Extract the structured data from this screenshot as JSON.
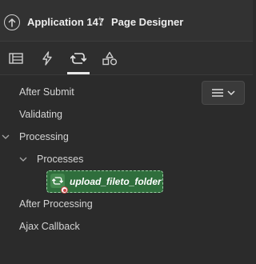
{
  "header": {
    "app_title": "Application 147",
    "separator": "\\",
    "page_title": "Page Designer"
  },
  "tabs": [
    {
      "name": "rendering",
      "icon": "layout-icon",
      "active": false
    },
    {
      "name": "dynamic-actions",
      "icon": "lightning-icon",
      "active": false
    },
    {
      "name": "processing",
      "icon": "refresh-icon",
      "active": true
    },
    {
      "name": "shared-components",
      "icon": "shapes-icon",
      "active": false
    }
  ],
  "toolbar": {
    "menu_icon": "hamburger-icon",
    "dropdown_icon": "chevron-down-icon"
  },
  "tree": {
    "after_submit": "After Submit",
    "validating": "Validating",
    "processing": "Processing",
    "processes": "Processes",
    "selected_process": "upload_fileto_folder",
    "after_processing": "After Processing",
    "ajax_callback": "Ajax Callback"
  },
  "colors": {
    "background": "#2b2b2b",
    "selected_node": "#2f6e3c",
    "error_badge": "#c94545"
  }
}
